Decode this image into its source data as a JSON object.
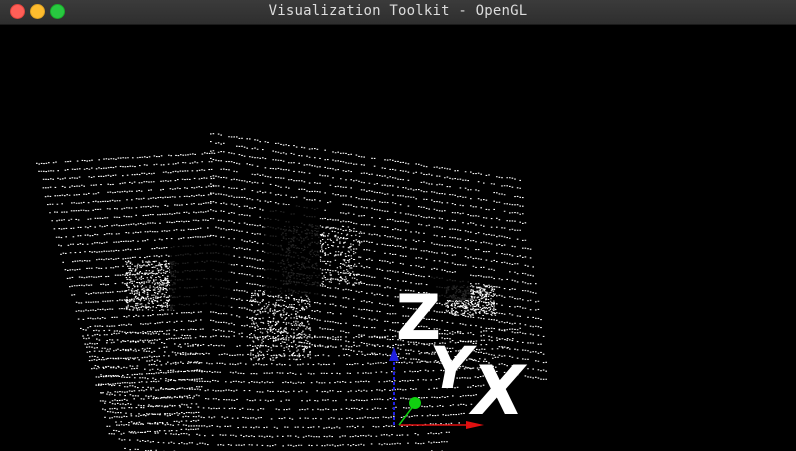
{
  "window": {
    "title": "Visualization Toolkit - OpenGL"
  },
  "axes": {
    "x_label": "X",
    "y_label": "Y",
    "z_label": "Z",
    "x_color": "#e01010",
    "y_color": "#10d010",
    "z_color": "#2020e0"
  },
  "colors": {
    "background": "#000000",
    "points": "#ffffff"
  }
}
